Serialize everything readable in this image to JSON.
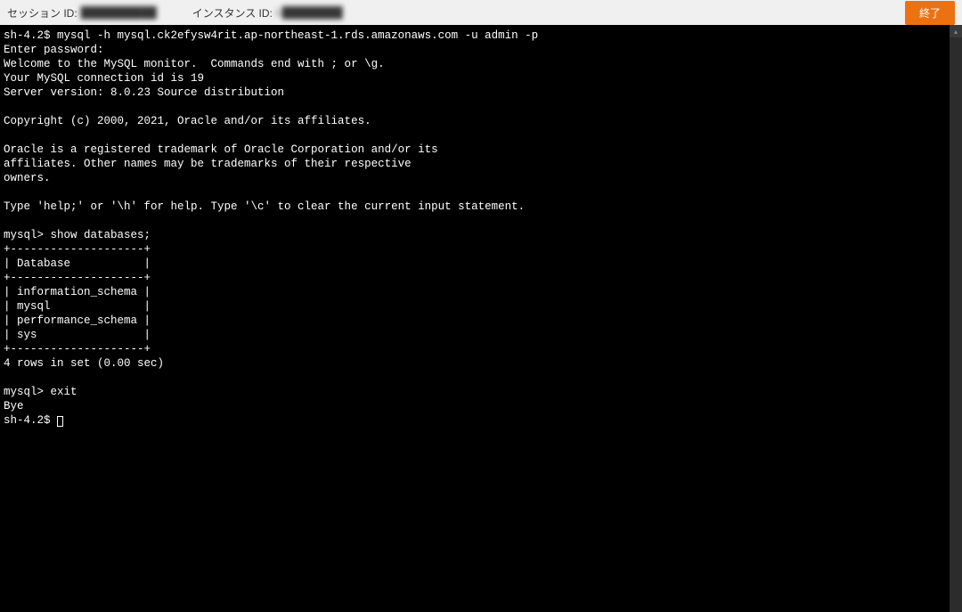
{
  "header": {
    "session_label": "セッション ID:",
    "session_value": "██████████",
    "instance_label": "インスタンス ID:",
    "instance_value": "i-████████",
    "exit_label": "終了"
  },
  "terminal": {
    "lines": [
      "sh-4.2$ mysql -h mysql.ck2efysw4rit.ap-northeast-1.rds.amazonaws.com -u admin -p",
      "Enter password:",
      "Welcome to the MySQL monitor.  Commands end with ; or \\g.",
      "Your MySQL connection id is 19",
      "Server version: 8.0.23 Source distribution",
      "",
      "Copyright (c) 2000, 2021, Oracle and/or its affiliates.",
      "",
      "Oracle is a registered trademark of Oracle Corporation and/or its",
      "affiliates. Other names may be trademarks of their respective",
      "owners.",
      "",
      "Type 'help;' or '\\h' for help. Type '\\c' to clear the current input statement.",
      "",
      "mysql> show databases;",
      "+--------------------+",
      "| Database           |",
      "+--------------------+",
      "| information_schema |",
      "| mysql              |",
      "| performance_schema |",
      "| sys                |",
      "+--------------------+",
      "4 rows in set (0.00 sec)",
      "",
      "mysql> exit",
      "Bye",
      "sh-4.2$ "
    ]
  }
}
